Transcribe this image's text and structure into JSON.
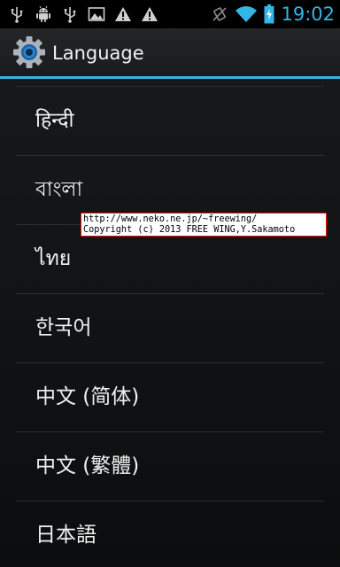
{
  "status_bar": {
    "time": "19:02",
    "left_icons": [
      "usb-icon",
      "android-debug-icon",
      "usb-icon",
      "image-icon",
      "warning-icon",
      "warning-icon"
    ],
    "right_icons": [
      "vibrate-icon",
      "wifi-icon",
      "battery-charging-icon"
    ],
    "accent": "#33b5e5"
  },
  "action_bar": {
    "title": "Language",
    "icon": "settings-gear-icon"
  },
  "languages": [
    {
      "label": "हिन्दी"
    },
    {
      "label": "বাংলা"
    },
    {
      "label": "ไทย"
    },
    {
      "label": "한국어"
    },
    {
      "label": "中文 (简体)"
    },
    {
      "label": "中文 (繁體)"
    },
    {
      "label": "日本語"
    }
  ],
  "overlay": {
    "line1": "http://www.neko.ne.jp/~freewing/",
    "line2": "Copyright (c) 2013 FREE WING,Y.Sakamoto"
  }
}
